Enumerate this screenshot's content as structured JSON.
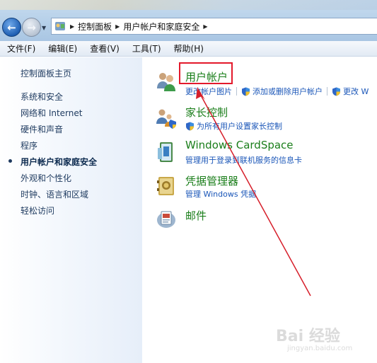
{
  "address_bar": {
    "breadcrumbs": [
      "控制面板",
      "用户帐户和家庭安全"
    ],
    "icon": "control-panel-icon"
  },
  "menu": [
    "文件(F)",
    "编辑(E)",
    "查看(V)",
    "工具(T)",
    "帮助(H)"
  ],
  "left_nav": {
    "items": [
      {
        "label": "控制面板主页",
        "current": false
      },
      {
        "label": "系统和安全",
        "current": false
      },
      {
        "label": "网络和 Internet",
        "current": false
      },
      {
        "label": "硬件和声音",
        "current": false
      },
      {
        "label": "程序",
        "current": false
      },
      {
        "label": "用户帐户和家庭安全",
        "current": true
      },
      {
        "label": "外观和个性化",
        "current": false
      },
      {
        "label": "时钟、语言和区域",
        "current": false
      },
      {
        "label": "轻松访问",
        "current": false
      }
    ]
  },
  "categories": [
    {
      "title": "用户帐户",
      "icon": "user-accounts-icon",
      "links": [
        "更改帐户图片",
        "添加或删除用户帐户",
        "更改 W"
      ]
    },
    {
      "title": "家长控制",
      "icon": "parental-controls-icon",
      "links": [
        "为所有用户设置家长控制"
      ]
    },
    {
      "title": "Windows CardSpace",
      "icon": "cardspace-icon",
      "links": [
        "管理用于登录到联机服务的信息卡"
      ]
    },
    {
      "title": "凭据管理器",
      "icon": "credential-manager-icon",
      "links": [
        "管理 Windows 凭据"
      ]
    },
    {
      "title": "邮件",
      "icon": "mail-icon",
      "links": []
    }
  ],
  "watermark": {
    "text": "Bai 经验",
    "url_text": "jingyan.baidu.com"
  },
  "colors": {
    "category_title": "#1a7e1a",
    "link": "#1a56b8",
    "highlight": "#e3192b"
  }
}
